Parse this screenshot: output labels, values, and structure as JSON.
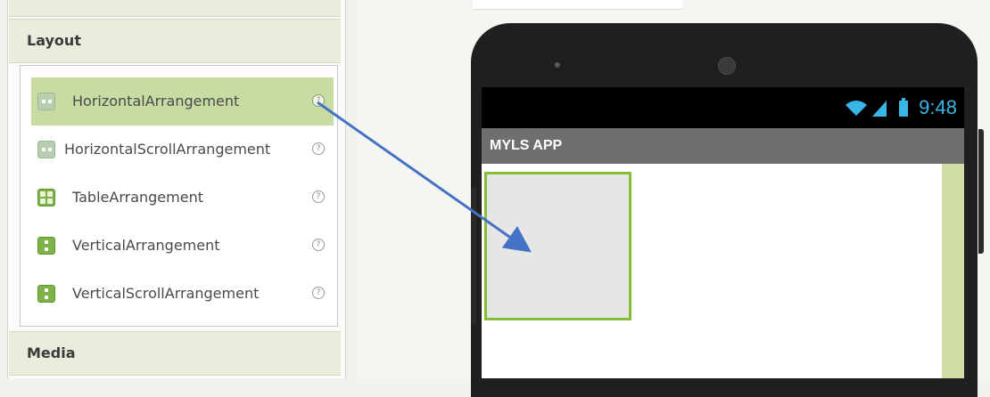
{
  "palette": {
    "sections": [
      {
        "title": "Layout"
      },
      {
        "title": "Media"
      }
    ],
    "layout_items": [
      {
        "label": "HorizontalArrangement",
        "icon": "horizontal-arrangement-icon",
        "selected": true
      },
      {
        "label": "HorizontalScrollArrangement",
        "icon": "horizontal-scroll-arrangement-icon",
        "selected": false
      },
      {
        "label": "TableArrangement",
        "icon": "table-arrangement-icon",
        "selected": false
      },
      {
        "label": "VerticalArrangement",
        "icon": "vertical-arrangement-icon",
        "selected": false
      },
      {
        "label": "VerticalScrollArrangement",
        "icon": "vertical-scroll-arrangement-icon",
        "selected": false
      }
    ],
    "help_glyph": "?"
  },
  "phone": {
    "status_time": "9:48",
    "app_title": "MYLS APP"
  },
  "colors": {
    "selected_item": "#c7dba3",
    "section_header": "#e8eddc",
    "arrow": "#4472c4",
    "drop_border": "#86bd3b",
    "status_icons": "#38b7e6",
    "title_bar": "#6f6f6f"
  }
}
